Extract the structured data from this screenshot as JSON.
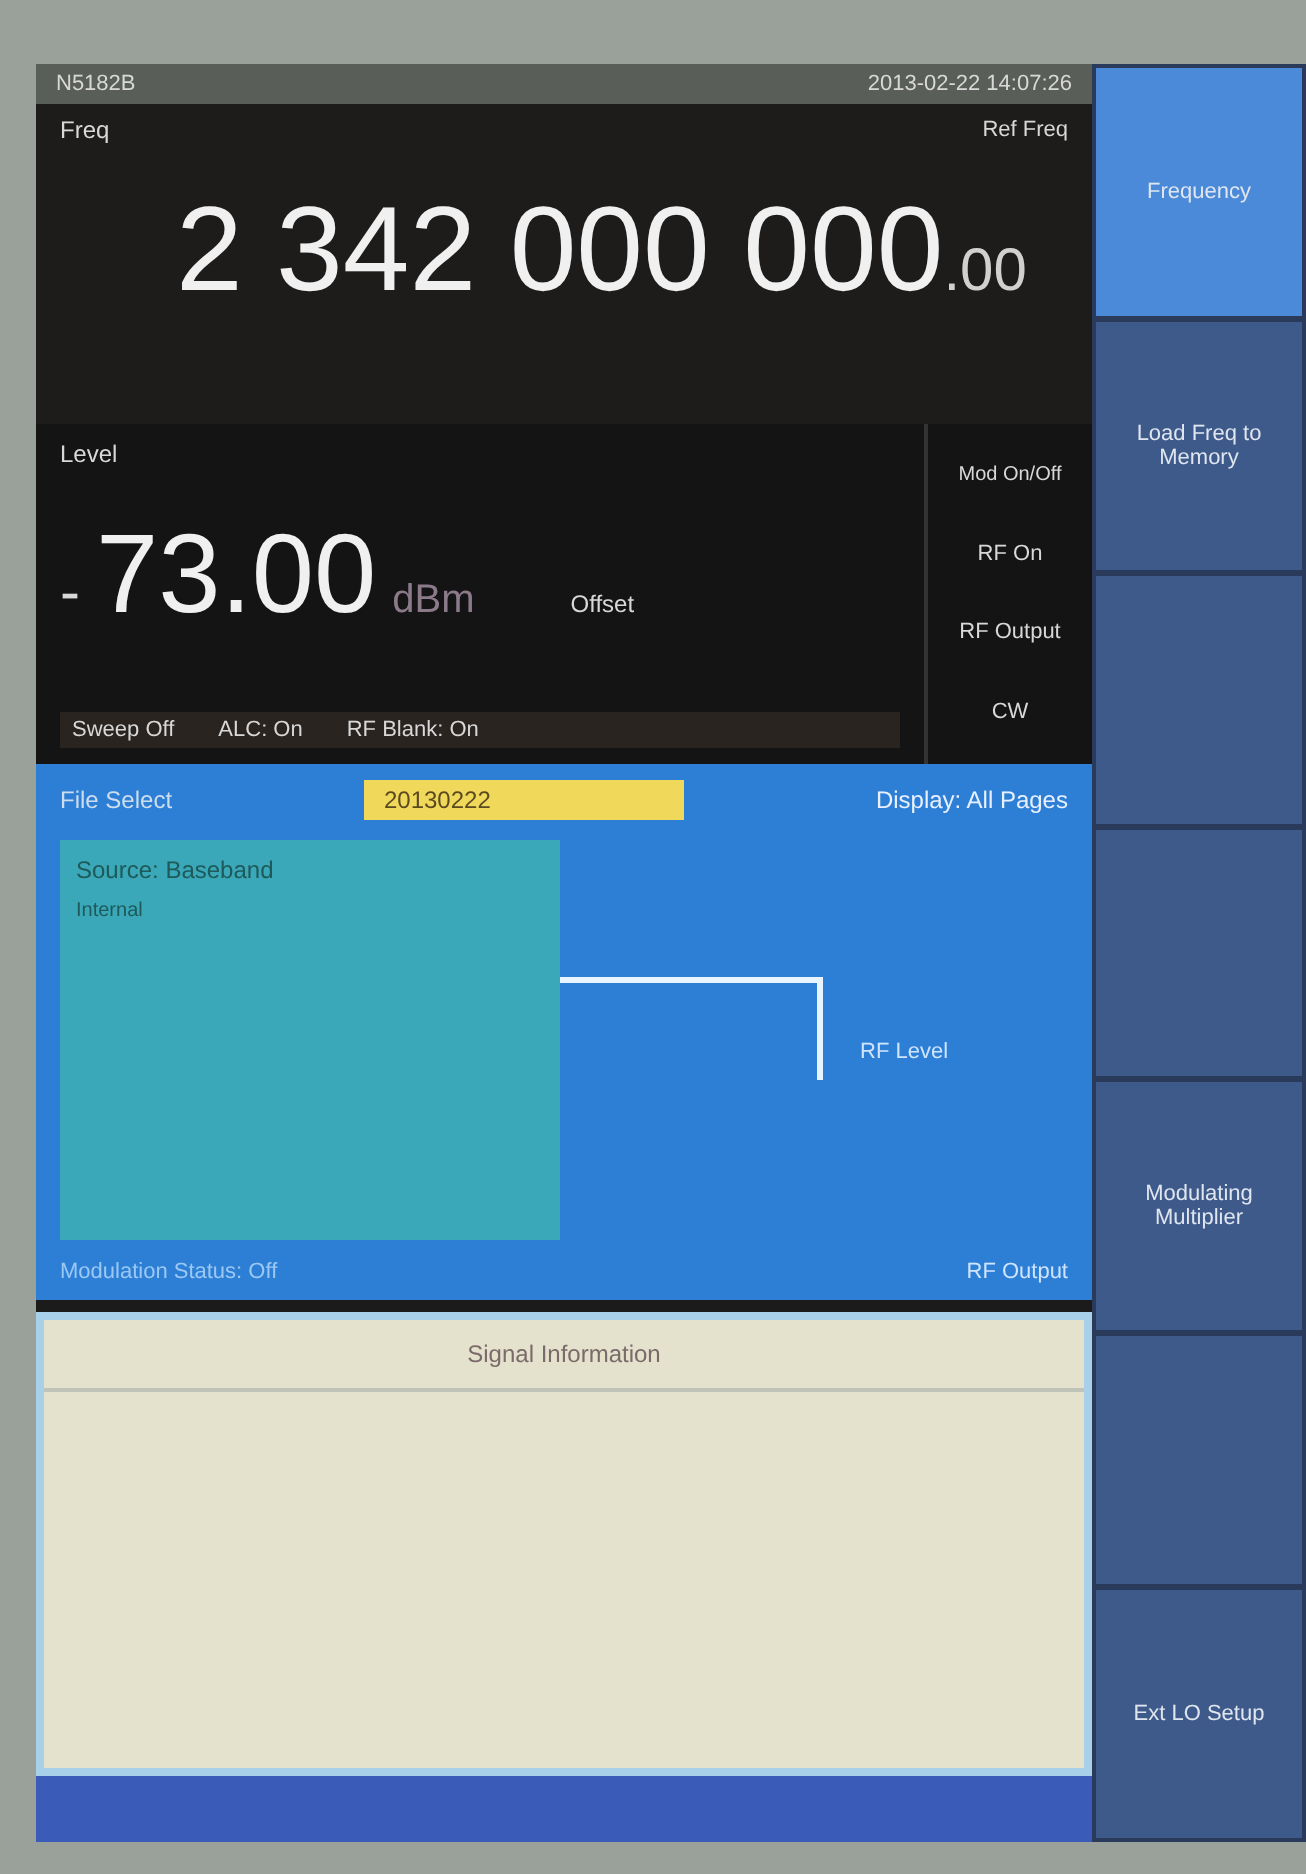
{
  "status_bar": {
    "title": "N5182B",
    "datetime": "2013-02-22 14:07:26"
  },
  "frequency": {
    "label": "Freq",
    "ref": "Ref Freq",
    "value": "2 342 000 000",
    "decimals": ".00"
  },
  "amplitude": {
    "label": "Level",
    "offset_label": "Offset",
    "sign": "-",
    "value": "73.00",
    "unit": "dBm",
    "status": [
      {
        "text": "Sweep Off"
      },
      {
        "text": "ALC: On"
      },
      {
        "text": "RF Blank: On"
      }
    ]
  },
  "rf_panel": {
    "title": "Mod On/Off",
    "rf_on": "RF On",
    "output": "RF Output",
    "output_state": "CW"
  },
  "block_diagram": {
    "label": "File Select",
    "file": "20130222",
    "view": "Display: All Pages",
    "box_title": "Source: Baseband",
    "box_sub": "Internal",
    "rf_level_label": "RF Level",
    "rf_output_label": "RF Output",
    "footer": "Modulation Status: Off"
  },
  "info_panel": {
    "title": "Signal Information"
  },
  "softkeys": [
    {
      "label": "Frequency",
      "selected": true
    },
    {
      "label": "Load Freq to Memory",
      "selected": false
    },
    {
      "selected": false
    },
    {
      "selected": false
    },
    {
      "label": "Modulating Multiplier",
      "selected": false
    },
    {
      "selected": false
    },
    {
      "label": "Ext LO Setup",
      "selected": false
    }
  ]
}
